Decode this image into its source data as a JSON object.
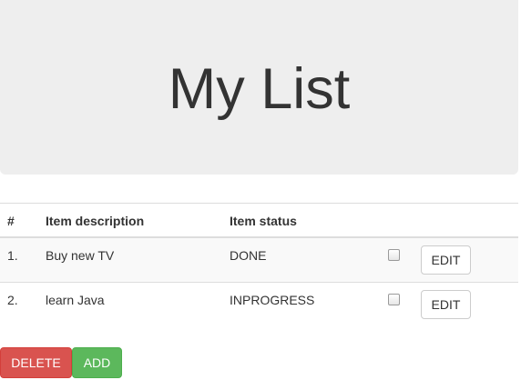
{
  "header": {
    "title": "My List"
  },
  "table": {
    "columns": [
      "#",
      "Item description",
      "Item status"
    ],
    "rows": [
      {
        "num": "1.",
        "description": "Buy new TV",
        "status": "DONE",
        "checked": false,
        "edit_label": "EDIT"
      },
      {
        "num": "2.",
        "description": "learn Java",
        "status": "INPROGRESS",
        "checked": false,
        "edit_label": "EDIT"
      }
    ]
  },
  "actions": {
    "delete_label": "DELETE",
    "add_label": "ADD"
  },
  "colors": {
    "jumbotron_bg": "#eeeeee",
    "delete": "#d9534f",
    "add": "#5cb85c"
  }
}
